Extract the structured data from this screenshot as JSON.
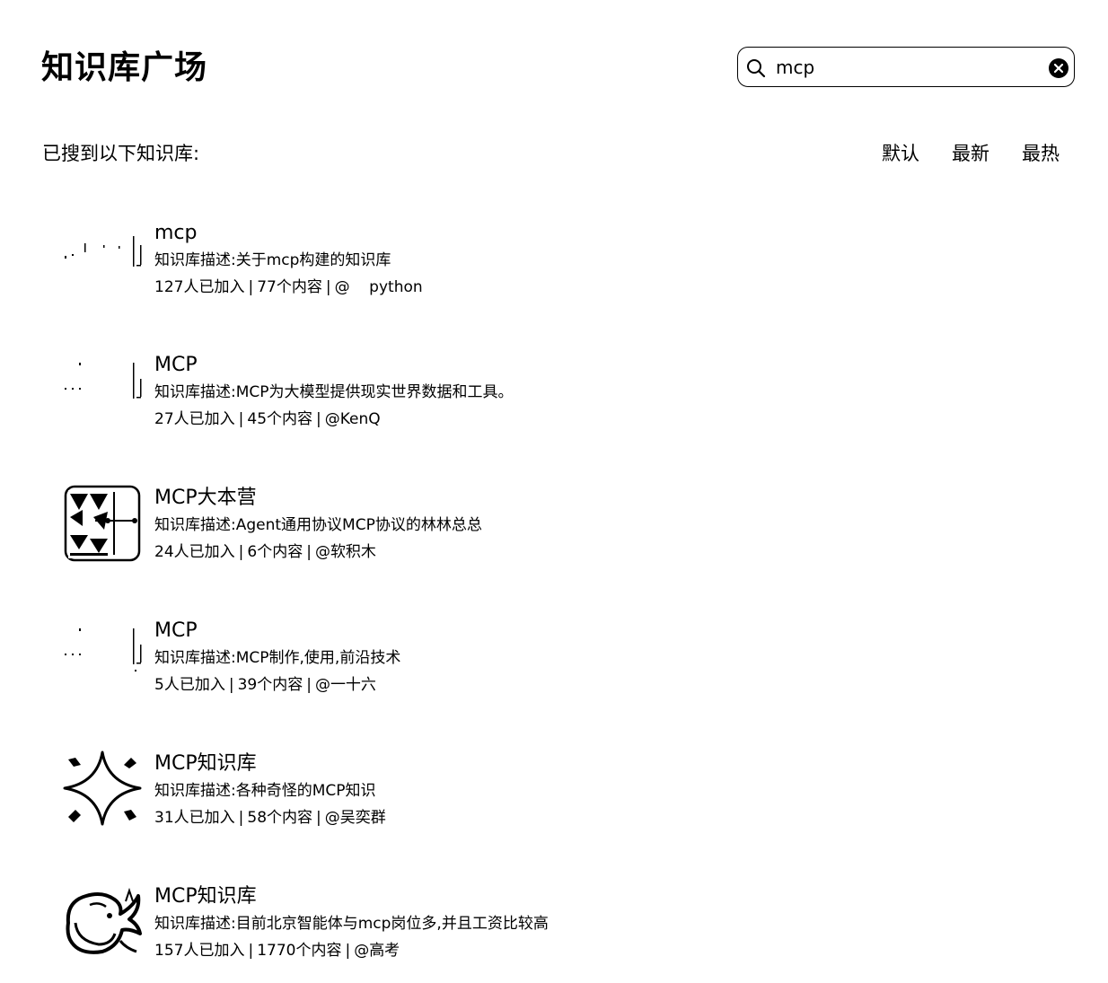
{
  "header": {
    "title": "知识库广场"
  },
  "search": {
    "value": "mcp",
    "placeholder": ""
  },
  "results": {
    "label": "已搜到以下知识库:",
    "sort_tabs": [
      {
        "label": "默认"
      },
      {
        "label": "最新"
      },
      {
        "label": "最热"
      }
    ]
  },
  "items": [
    {
      "name": "mcp",
      "description": "知识库描述:关于mcp构建的知识库",
      "members": "127人已加入",
      "contents": "77个内容",
      "author": "@    python",
      "icon": "broken-image-icon"
    },
    {
      "name": "MCP",
      "description": "知识库描述:MCP为大模型提供现实世界数据和工具。",
      "members": "27人已加入",
      "contents": "45个内容",
      "author": "@KenQ",
      "icon": "broken-image-icon"
    },
    {
      "name": "MCP大本营",
      "description": "知识库描述:Agent通用协议MCP协议的林林总总",
      "members": "24人已加入",
      "contents": "6个内容",
      "author": "@软积木",
      "icon": "network-logo-icon"
    },
    {
      "name": "MCP",
      "description": "知识库描述:MCP制作,使用,前沿技术",
      "members": "5人已加入",
      "contents": "39个内容",
      "author": "@一十六",
      "icon": "broken-image-icon"
    },
    {
      "name": "MCP知识库",
      "description": "知识库描述:各种奇怪的MCP知识",
      "members": "31人已加入",
      "contents": "58个内容",
      "author": "@吴奕群",
      "icon": "sparkle-star-icon"
    },
    {
      "name": "MCP知识库",
      "description": "知识库描述:目前北京智能体与mcp岗位多,并且工资比较高",
      "members": "157人已加入",
      "contents": "1770个内容",
      "author": "@高考",
      "icon": "whale-logo-icon"
    }
  ],
  "meta_separator": "|"
}
